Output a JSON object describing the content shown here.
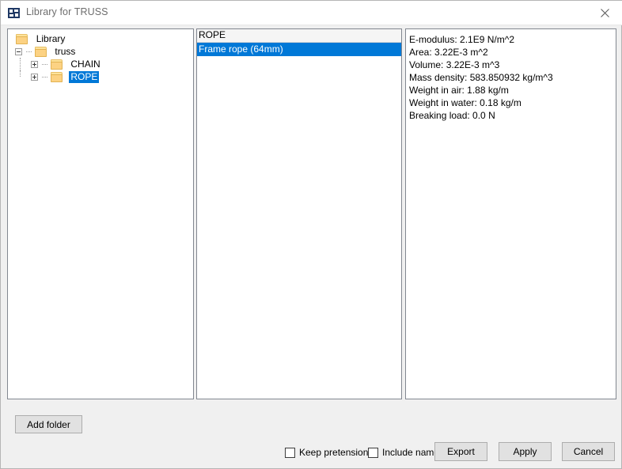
{
  "window": {
    "title": "Library for TRUSS",
    "icon": "application-icon",
    "close_label": "✕"
  },
  "tree": {
    "nodes": [
      {
        "label": "Library",
        "level": 0,
        "expander": "none",
        "selected": false
      },
      {
        "label": "truss",
        "level": 1,
        "expander": "minus",
        "selected": false
      },
      {
        "label": "CHAIN",
        "level": 2,
        "expander": "plus",
        "selected": false
      },
      {
        "label": "ROPE",
        "level": 2,
        "expander": "plus",
        "selected": true
      }
    ]
  },
  "list": {
    "header": "ROPE",
    "items": [
      {
        "label": "Frame rope (64mm)",
        "selected": true
      }
    ]
  },
  "properties": {
    "lines": [
      "E-modulus: 2.1E9 N/m^2",
      "Area: 3.22E-3 m^2",
      "Volume: 3.22E-3 m^3",
      "Mass density: 583.850932 kg/m^3",
      "Weight in air: 1.88 kg/m",
      "Weight in water: 0.18 kg/m",
      "Breaking load: 0.0 N"
    ]
  },
  "footer": {
    "add_folder_label": "Add folder",
    "keep_pretension_label": "Keep pretension",
    "keep_pretension_checked": false,
    "include_name_label": "Include name",
    "include_name_checked": false,
    "export_label": "Export",
    "apply_label": "Apply",
    "cancel_label": "Cancel"
  },
  "colors": {
    "selection": "#0078d7",
    "dialog_bg": "#f0f0f0",
    "panel_border": "#828790",
    "button_face": "#e1e1e1"
  }
}
